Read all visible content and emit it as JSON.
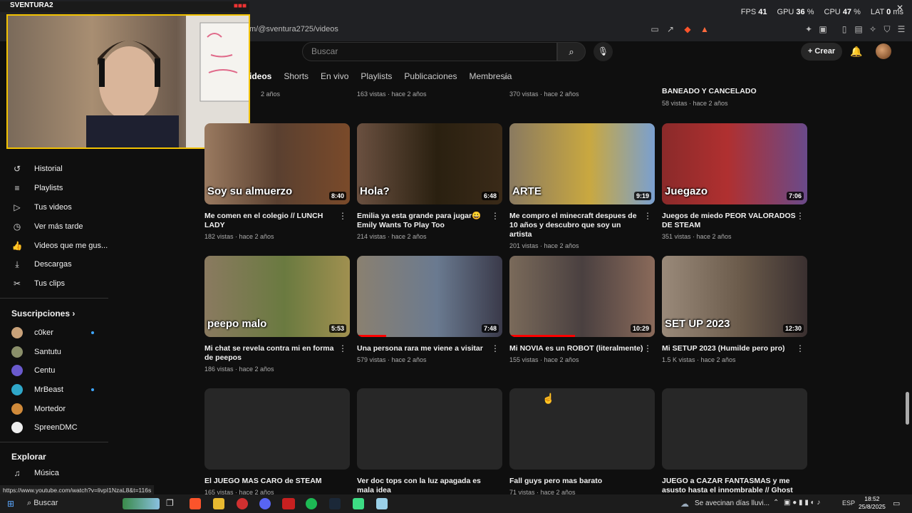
{
  "perf": {
    "fps_label": "FPS",
    "fps": "41",
    "gpu_label": "GPU",
    "gpu": "36",
    "gpu_unit": "%",
    "cpu_label": "CPU",
    "cpu": "47",
    "cpu_unit": "%",
    "lat_label": "LAT",
    "lat": "0",
    "lat_unit": "ms"
  },
  "browser": {
    "url": "m/@sventura2725/videos"
  },
  "webcam": {
    "title": "SVENTURA2"
  },
  "header": {
    "search_placeholder": "Buscar",
    "create_label": "Crear"
  },
  "tabs": [
    {
      "label": "ideos",
      "active": true
    },
    {
      "label": "Shorts"
    },
    {
      "label": "En vivo"
    },
    {
      "label": "Playlists"
    },
    {
      "label": "Publicaciones"
    },
    {
      "label": "Membresía"
    }
  ],
  "sidebar": {
    "items": [
      {
        "label": "Historial",
        "icon": "history-icon",
        "glyph": "↺"
      },
      {
        "label": "Playlists",
        "icon": "playlists-icon",
        "glyph": "≡"
      },
      {
        "label": "Tus videos",
        "icon": "your-videos-icon",
        "glyph": "▷"
      },
      {
        "label": "Ver más tarde",
        "icon": "watch-later-icon",
        "glyph": "◷"
      },
      {
        "label": "Videos que me gus...",
        "icon": "like-icon",
        "glyph": "👍"
      },
      {
        "label": "Descargas",
        "icon": "download-icon",
        "glyph": "⤓"
      },
      {
        "label": "Tus clips",
        "icon": "scissors-icon",
        "glyph": "✂"
      }
    ],
    "subscriptions_title": "Suscripciones",
    "subscriptions": [
      {
        "name": "c0ker",
        "color": "#c9a27a",
        "dot": true
      },
      {
        "name": "Santutu",
        "color": "#8a8f6a",
        "dot": false
      },
      {
        "name": "Centu",
        "color": "#6a5acd",
        "dot": false
      },
      {
        "name": "MrBeast",
        "color": "#2fa7c9",
        "dot": true
      },
      {
        "name": "Mortedor",
        "color": "#d08a3a",
        "dot": false
      },
      {
        "name": "SpreenDMC",
        "color": "#eeeeee",
        "dot": false
      }
    ],
    "explore_title": "Explorar",
    "explore_items": [
      {
        "label": "Música",
        "icon": "music-icon",
        "glyph": "♫"
      }
    ]
  },
  "top_row": [
    {
      "meta": "2 años"
    },
    {
      "meta": "163 vistas · hace 2 años"
    },
    {
      "meta": "370 vistas · hace 2 años"
    },
    {
      "title": "BANEADO Y CANCELADO",
      "meta": "58 vistas · hace 2 años"
    }
  ],
  "videos_row1": [
    {
      "caption": "Soy su almuerzo",
      "duration": "8:40",
      "title": "Me comen en el colegio // LUNCH LADY",
      "meta": "182 vistas · hace 2 años",
      "bg": "linear-gradient(90deg,#9a7a60,#5a4030 50%,#7a4a2a)",
      "progress": 0
    },
    {
      "caption": "Hola?",
      "duration": "6:48",
      "title": "Emilia ya esta grande para jugar😀 Emily Wants To Play Too",
      "meta": "214 vistas · hace 2 años",
      "bg": "linear-gradient(90deg,#6a5040,#2a2010 55%,#3a2a18)",
      "progress": 0
    },
    {
      "caption": "ARTE",
      "duration": "9:19",
      "title": "Me compro el minecraft despues de 10 años y descubro que soy un artista",
      "meta": "201 vistas · hace 2 años",
      "bg": "linear-gradient(90deg,#8a7a60,#c9a840 55%,#7aa0d0)",
      "progress": 0
    },
    {
      "caption": "Juegazo",
      "duration": "7:06",
      "title": "Juegos de miedo PEOR VALORADOS DE STEAM",
      "meta": "351 vistas · hace 2 años",
      "bg": "linear-gradient(90deg,#8a2a2a,#b03030 45%,#6a4a8a)",
      "progress": 0
    }
  ],
  "videos_row2": [
    {
      "caption": "peepo malo",
      "duration": "5:53",
      "title": "Mi chat se revela contra mi en forma de peepos",
      "meta": "186 vistas · hace 2 años",
      "bg": "linear-gradient(90deg,#8a7a60,#6a7a40 55%,#a09050)",
      "progress": 0
    },
    {
      "caption": "",
      "duration": "7:48",
      "title": "Una persona rara me viene a visitar",
      "meta": "579 vistas · hace 2 años",
      "bg": "linear-gradient(90deg,#8a8070,#6a7a90 55%,#3a3a4a)",
      "progress": 0.2
    },
    {
      "caption": "",
      "duration": "10:29",
      "title": "Mi NOVIA es un ROBOT (literalmente)",
      "meta": "155 vistas · hace 2 años",
      "bg": "linear-gradient(90deg,#7a6a5a,#4a4040 50%,#8a6a5a)",
      "progress": 0.45
    },
    {
      "caption": "SET UP 2023",
      "duration": "12:30",
      "title": "Mi SETUP 2023 (Humilde pero pro)",
      "meta": "1.5 K vistas · hace 2 años",
      "bg": "linear-gradient(90deg,#9a8a7a,#6a5a4a 55%,#3a3030)",
      "progress": 0
    }
  ],
  "videos_row3": [
    {
      "title": "El JUEGO MAS CARO de STEAM",
      "meta": "165 vistas · hace 2 años"
    },
    {
      "title": "Ver doc tops con la luz apagada es mala idea",
      "meta": ""
    },
    {
      "title": "Fall guys pero mas barato",
      "meta": "71 vistas · hace 2 años"
    },
    {
      "title": "JUEGO a CAZAR FANTASMAS y me asusto hasta el innombrable // Ghost watchers",
      "meta": ""
    }
  ],
  "status_url": "https://www.youtube.com/watch?v=livpI1NzaL8&t=116s",
  "taskbar": {
    "search": "Buscar",
    "weather": "Se avecinan días lluvi...",
    "lang": "ESP",
    "time": "18:52",
    "date": "25/8/2025"
  }
}
